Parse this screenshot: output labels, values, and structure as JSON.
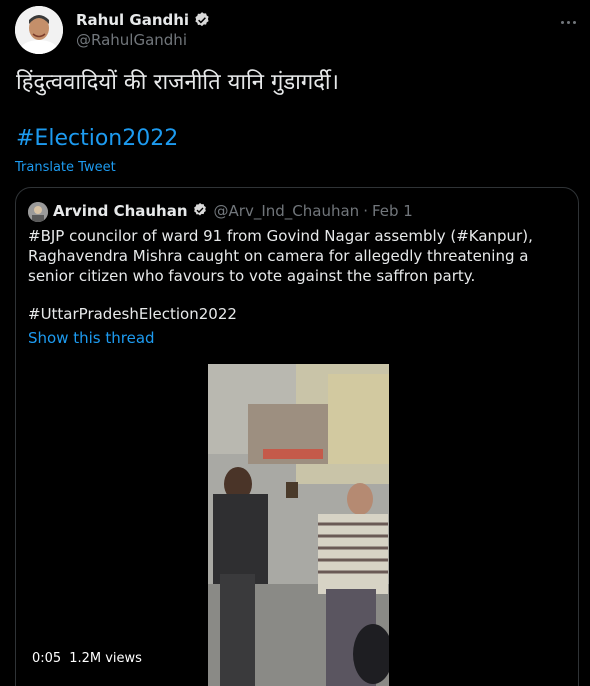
{
  "author": {
    "name": "Rahul Gandhi",
    "handle": "@RahulGandhi",
    "avatar": "profile-photo"
  },
  "icons": {
    "verified": "verified-badge-icon",
    "more": "more-options-icon"
  },
  "tweet": {
    "text": "हिंदुत्ववादियों की राजनीति यानि गुंडागर्दी।",
    "hashtag": "#Election2022",
    "translate_label": "Translate Tweet"
  },
  "quote": {
    "name": "Arvind Chauhan",
    "handle": "@Arv_Ind_Chauhan",
    "separator": "·",
    "date": "Feb 1",
    "text": "#BJP councilor of ward 91 from Govind Nagar assembly (#Kanpur), Raghavendra Mishra caught on camera for allegedly threatening a senior citizen who favours to vote against the saffron party.",
    "tag": "#UttarPradeshElection2022",
    "show_thread": "Show this thread",
    "video": {
      "time": "0:05",
      "views": "1.2M views"
    }
  },
  "colors": {
    "background": "#000000",
    "text": "#e7e9ea",
    "muted": "#71767b",
    "link": "#1d9bf0",
    "border": "#2f3336"
  }
}
